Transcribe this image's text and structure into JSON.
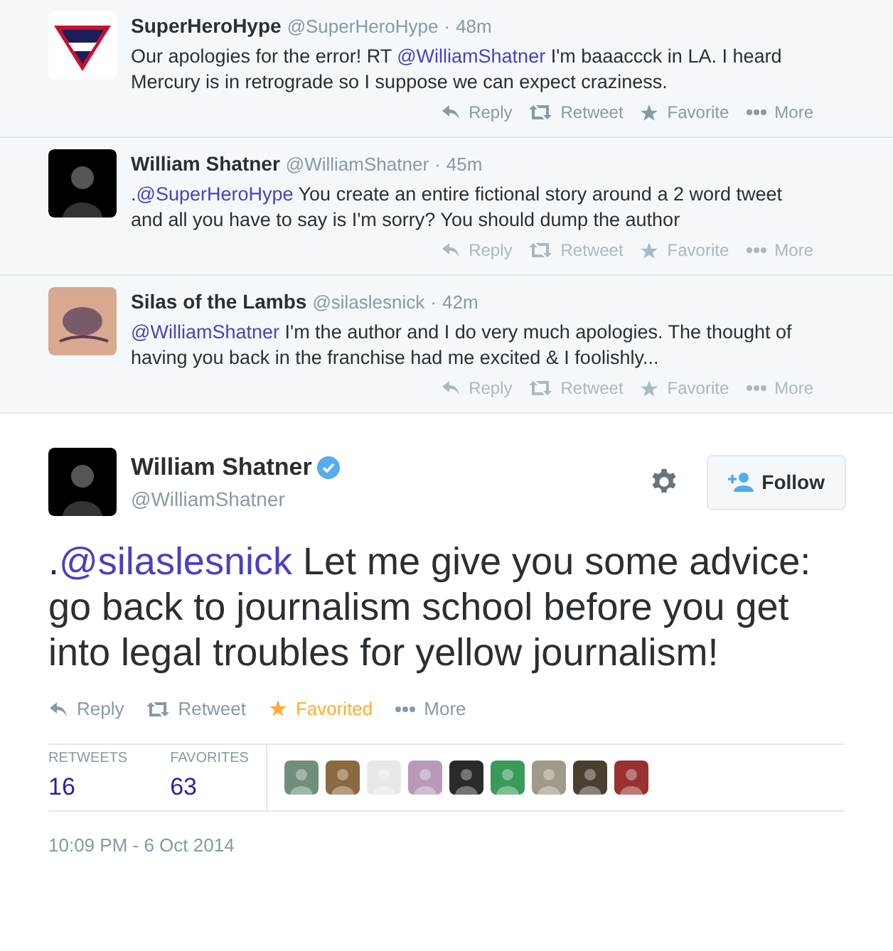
{
  "replies": [
    {
      "avatar": {
        "kind": "logo"
      },
      "name": "SuperHeroHype",
      "handle": "@SuperHeroHype",
      "separator": "·",
      "time": "48m",
      "text": [
        {
          "kind": "plain",
          "text": "Our apologies for the error! RT "
        },
        {
          "kind": "mention",
          "text": "@WilliamShatner"
        },
        {
          "kind": "plain",
          "text": " I'm baaaccck in LA. I heard Mercury is in retrograde so I suppose we can expect craziness."
        }
      ],
      "actions_dimmed": false,
      "actions": [
        "Reply",
        "Retweet",
        "Favorite",
        "More"
      ]
    },
    {
      "avatar": {
        "kind": "dark"
      },
      "name": "William Shatner",
      "handle": "@WilliamShatner",
      "separator": "·",
      "time": "45m",
      "text": [
        {
          "kind": "plain",
          "text": "."
        },
        {
          "kind": "mention",
          "text": "@SuperHeroHype"
        },
        {
          "kind": "plain",
          "text": " You create an entire fictional story around a 2 word tweet and all you have to say is I'm sorry? You should dump the author"
        }
      ],
      "actions_dimmed": true,
      "actions": [
        "Reply",
        "Retweet",
        "Favorite",
        "More"
      ]
    },
    {
      "avatar": {
        "kind": "skin"
      },
      "name": "Silas of the Lambs",
      "handle": "@silaslesnick",
      "separator": "·",
      "time": "42m",
      "text": [
        {
          "kind": "mention",
          "text": "@WilliamShatner"
        },
        {
          "kind": "plain",
          "text": " I'm the author and I do very much apologies. The thought of having you back in the franchise had me excited & I foolishly..."
        }
      ],
      "actions_dimmed": true,
      "actions": [
        "Reply",
        "Retweet",
        "Favorite",
        "More"
      ]
    }
  ],
  "tweet": {
    "name": "William Shatner",
    "verified": true,
    "handle": "@WilliamShatner",
    "follow": "Follow",
    "text": [
      {
        "kind": "plain",
        "text": "."
      },
      {
        "kind": "mention",
        "text": "@silaslesnick"
      },
      {
        "kind": "plain",
        "text": " Let me give you some advice: go back to journalism school before you get into legal troubles for yellow journalism!"
      }
    ],
    "actions": [
      "Reply",
      "Retweet",
      "Favorited",
      "More"
    ],
    "favorited": true,
    "stats": [
      {
        "label": "RETWEETS",
        "value": "16"
      },
      {
        "label": "FAVORITES",
        "value": "63"
      }
    ],
    "favoriters": [
      {
        "color": "#6f8f7a"
      },
      {
        "color": "#8a6a40"
      },
      {
        "color": "#e8e8e8"
      },
      {
        "color": "#b89ab8"
      },
      {
        "color": "#2a2a2a"
      },
      {
        "color": "#3a9a5a"
      },
      {
        "color": "#a09a8a"
      },
      {
        "color": "#4a4030"
      },
      {
        "color": "#9a3030"
      }
    ],
    "timestamp": "10:09 PM - 6 Oct 2014"
  }
}
